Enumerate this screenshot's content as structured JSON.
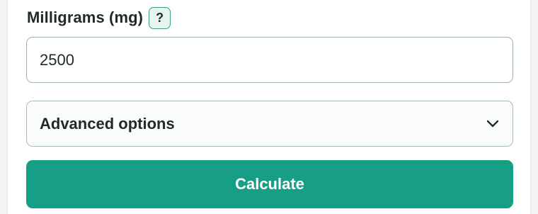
{
  "field": {
    "label": "Milligrams (mg)",
    "help_label": "?",
    "value": "2500"
  },
  "advanced": {
    "label": "Advanced options",
    "icon": "chevron-down-icon"
  },
  "calculate": {
    "label": "Calculate"
  },
  "colors": {
    "accent": "#179f86",
    "help_border": "#3c9c86",
    "help_bg": "#e6f4f0",
    "text": "#1f2a2a"
  }
}
